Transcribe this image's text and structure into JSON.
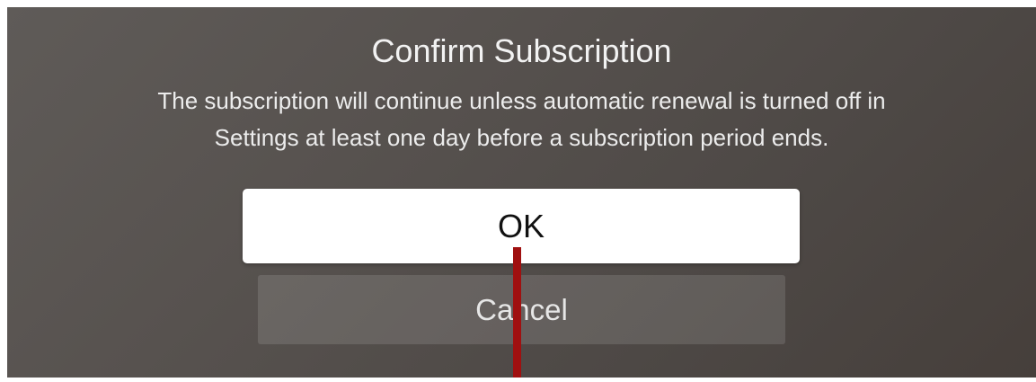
{
  "dialog": {
    "title": "Confirm Subscription",
    "message": "The subscription will continue unless automatic renewal is turned off in\nSettings at least one day before a subscription period ends.",
    "buttons": {
      "ok_label": "OK",
      "cancel_label": "Cancel"
    }
  },
  "colors": {
    "background": "#56514e",
    "ok_button": "#ffffff",
    "pointer_annotation": "#a01010"
  }
}
